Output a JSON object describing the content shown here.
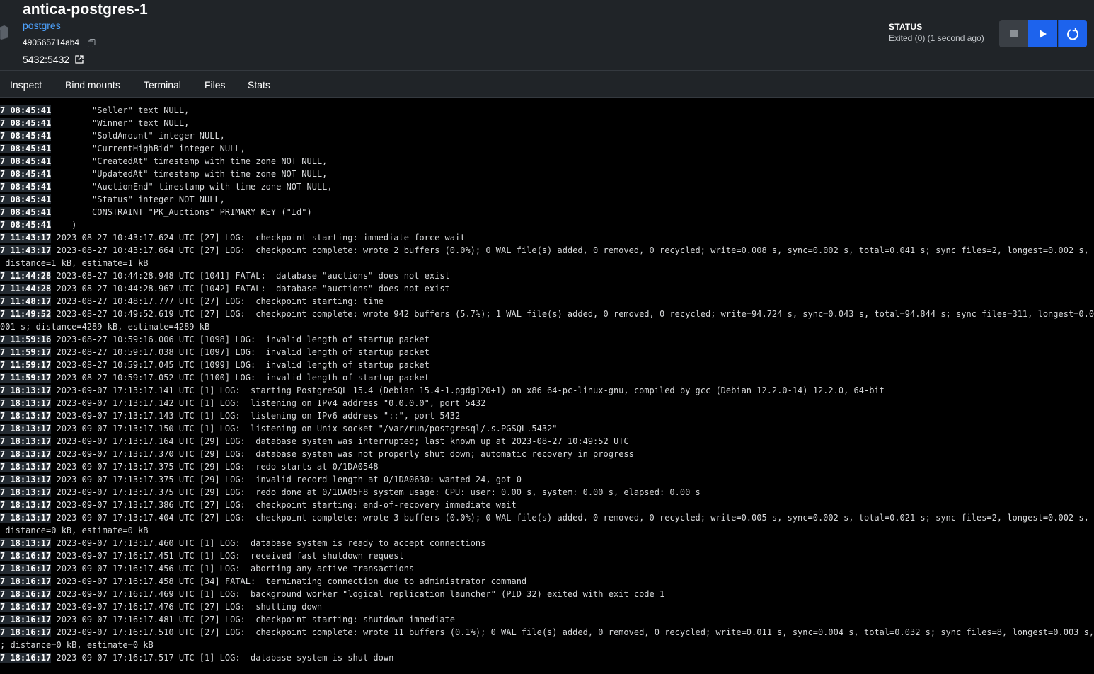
{
  "header": {
    "title": "antica-postgres-1",
    "image_link": "postgres",
    "container_id": "490565714ab4",
    "port": "5432:5432",
    "status_label": "STATUS",
    "status_value": "Exited (0) (1 second ago)"
  },
  "icons": [
    "container-icon",
    "copy-icon",
    "external-link-icon",
    "stop-icon",
    "play-icon",
    "restart-icon"
  ],
  "colors": {
    "accent": "#1d63ed",
    "link": "#4ea3ff",
    "header_bg": "#202428",
    "log_bg": "#000000"
  },
  "tabs": [
    {
      "label": "Inspect"
    },
    {
      "label": "Bind mounts"
    },
    {
      "label": "Terminal"
    },
    {
      "label": "Files"
    },
    {
      "label": "Stats"
    }
  ],
  "logs": [
    {
      "ts": "7 08:45:41",
      "text": "        \"Seller\" text NULL,"
    },
    {
      "ts": "7 08:45:41",
      "text": "        \"Winner\" text NULL,"
    },
    {
      "ts": "7 08:45:41",
      "text": "        \"SoldAmount\" integer NULL,"
    },
    {
      "ts": "7 08:45:41",
      "text": "        \"CurrentHighBid\" integer NULL,"
    },
    {
      "ts": "7 08:45:41",
      "text": "        \"CreatedAt\" timestamp with time zone NOT NULL,"
    },
    {
      "ts": "7 08:45:41",
      "text": "        \"UpdatedAt\" timestamp with time zone NOT NULL,"
    },
    {
      "ts": "7 08:45:41",
      "text": "        \"AuctionEnd\" timestamp with time zone NOT NULL,"
    },
    {
      "ts": "7 08:45:41",
      "text": "        \"Status\" integer NOT NULL,"
    },
    {
      "ts": "7 08:45:41",
      "text": "        CONSTRAINT \"PK_Auctions\" PRIMARY KEY (\"Id\")"
    },
    {
      "ts": "7 08:45:41",
      "text": "    )"
    },
    {
      "ts": "7 11:43:17",
      "text": " 2023-08-27 10:43:17.624 UTC [27] LOG:  checkpoint starting: immediate force wait"
    },
    {
      "ts": "7 11:43:17",
      "text": " 2023-08-27 10:43:17.664 UTC [27] LOG:  checkpoint complete: wrote 2 buffers (0.0%); 0 WAL file(s) added, 0 removed, 0 recycled; write=0.008 s, sync=0.002 s, total=0.041 s; sync files=2, longest=0.002 s, average"
    },
    {
      "ts": "",
      "text": " distance=1 kB, estimate=1 kB"
    },
    {
      "ts": "7 11:44:28",
      "text": " 2023-08-27 10:44:28.948 UTC [1041] FATAL:  database \"auctions\" does not exist"
    },
    {
      "ts": "7 11:44:28",
      "text": " 2023-08-27 10:44:28.967 UTC [1042] FATAL:  database \"auctions\" does not exist"
    },
    {
      "ts": "7 11:48:17",
      "text": " 2023-08-27 10:48:17.777 UTC [27] LOG:  checkpoint starting: time"
    },
    {
      "ts": "7 11:49:52",
      "text": " 2023-08-27 10:49:52.619 UTC [27] LOG:  checkpoint complete: wrote 942 buffers (5.7%); 1 WAL file(s) added, 0 removed, 0 recycled; write=94.724 s, sync=0.043 s, total=94.844 s; sync files=311, longest=0.003 s, a"
    },
    {
      "ts": "",
      "text": "001 s; distance=4289 kB, estimate=4289 kB"
    },
    {
      "ts": "7 11:59:16",
      "text": " 2023-08-27 10:59:16.006 UTC [1098] LOG:  invalid length of startup packet"
    },
    {
      "ts": "7 11:59:17",
      "text": " 2023-08-27 10:59:17.038 UTC [1097] LOG:  invalid length of startup packet"
    },
    {
      "ts": "7 11:59:17",
      "text": " 2023-08-27 10:59:17.045 UTC [1099] LOG:  invalid length of startup packet"
    },
    {
      "ts": "7 11:59:17",
      "text": " 2023-08-27 10:59:17.052 UTC [1100] LOG:  invalid length of startup packet"
    },
    {
      "ts": "7 18:13:17",
      "text": " 2023-09-07 17:13:17.141 UTC [1] LOG:  starting PostgreSQL 15.4 (Debian 15.4-1.pgdg120+1) on x86_64-pc-linux-gnu, compiled by gcc (Debian 12.2.0-14) 12.2.0, 64-bit"
    },
    {
      "ts": "7 18:13:17",
      "text": " 2023-09-07 17:13:17.142 UTC [1] LOG:  listening on IPv4 address \"0.0.0.0\", port 5432"
    },
    {
      "ts": "7 18:13:17",
      "text": " 2023-09-07 17:13:17.143 UTC [1] LOG:  listening on IPv6 address \"::\", port 5432"
    },
    {
      "ts": "7 18:13:17",
      "text": " 2023-09-07 17:13:17.150 UTC [1] LOG:  listening on Unix socket \"/var/run/postgresql/.s.PGSQL.5432\""
    },
    {
      "ts": "7 18:13:17",
      "text": " 2023-09-07 17:13:17.164 UTC [29] LOG:  database system was interrupted; last known up at 2023-08-27 10:49:52 UTC"
    },
    {
      "ts": "7 18:13:17",
      "text": " 2023-09-07 17:13:17.370 UTC [29] LOG:  database system was not properly shut down; automatic recovery in progress"
    },
    {
      "ts": "7 18:13:17",
      "text": " 2023-09-07 17:13:17.375 UTC [29] LOG:  redo starts at 0/1DA0548"
    },
    {
      "ts": "7 18:13:17",
      "text": " 2023-09-07 17:13:17.375 UTC [29] LOG:  invalid record length at 0/1DA0630: wanted 24, got 0"
    },
    {
      "ts": "7 18:13:17",
      "text": " 2023-09-07 17:13:17.375 UTC [29] LOG:  redo done at 0/1DA05F8 system usage: CPU: user: 0.00 s, system: 0.00 s, elapsed: 0.00 s"
    },
    {
      "ts": "7 18:13:17",
      "text": " 2023-09-07 17:13:17.386 UTC [27] LOG:  checkpoint starting: end-of-recovery immediate wait"
    },
    {
      "ts": "7 18:13:17",
      "text": " 2023-09-07 17:13:17.404 UTC [27] LOG:  checkpoint complete: wrote 3 buffers (0.0%); 0 WAL file(s) added, 0 removed, 0 recycled; write=0.005 s, sync=0.002 s, total=0.021 s; sync files=2, longest=0.002 s, average"
    },
    {
      "ts": "",
      "text": " distance=0 kB, estimate=0 kB"
    },
    {
      "ts": "7 18:13:17",
      "text": " 2023-09-07 17:13:17.460 UTC [1] LOG:  database system is ready to accept connections"
    },
    {
      "ts": "7 18:16:17",
      "text": " 2023-09-07 17:16:17.451 UTC [1] LOG:  received fast shutdown request"
    },
    {
      "ts": "7 18:16:17",
      "text": " 2023-09-07 17:16:17.456 UTC [1] LOG:  aborting any active transactions"
    },
    {
      "ts": "7 18:16:17",
      "text": " 2023-09-07 17:16:17.458 UTC [34] FATAL:  terminating connection due to administrator command"
    },
    {
      "ts": "7 18:16:17",
      "text": " 2023-09-07 17:16:17.469 UTC [1] LOG:  background worker \"logical replication launcher\" (PID 32) exited with exit code 1"
    },
    {
      "ts": "7 18:16:17",
      "text": " 2023-09-07 17:16:17.476 UTC [27] LOG:  shutting down"
    },
    {
      "ts": "7 18:16:17",
      "text": " 2023-09-07 17:16:17.481 UTC [27] LOG:  checkpoint starting: shutdown immediate"
    },
    {
      "ts": "7 18:16:17",
      "text": " 2023-09-07 17:16:17.510 UTC [27] LOG:  checkpoint complete: wrote 11 buffers (0.1%); 0 WAL file(s) added, 0 removed, 0 recycled; write=0.011 s, sync=0.004 s, total=0.032 s; sync files=8, longest=0.003 s, averag"
    },
    {
      "ts": "",
      "text": "; distance=0 kB, estimate=0 kB"
    },
    {
      "ts": "7 18:16:17",
      "text": " 2023-09-07 17:16:17.517 UTC [1] LOG:  database system is shut down"
    }
  ]
}
